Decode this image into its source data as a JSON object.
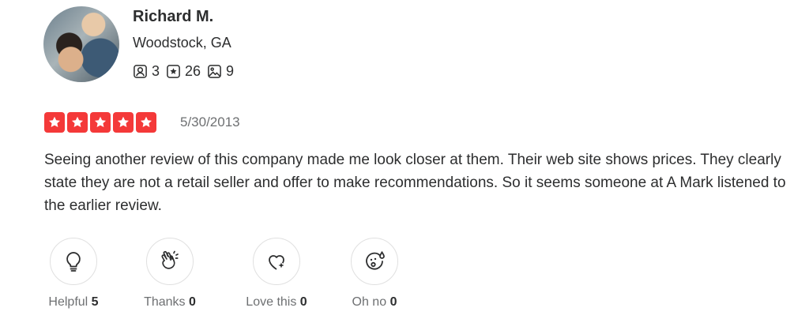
{
  "reviewer": {
    "name": "Richard M.",
    "location": "Woodstock, GA",
    "stats": [
      {
        "icon": "friends-icon",
        "value": "3"
      },
      {
        "icon": "reviews-star-icon",
        "value": "26"
      },
      {
        "icon": "photos-icon",
        "value": "9"
      }
    ]
  },
  "review": {
    "rating": 5,
    "max_rating": 5,
    "date": "5/30/2013",
    "text": "Seeing another review of this company made me look closer at them. Their web site shows prices. They clearly state they are not a retail seller and offer to make recommendations. So it seems someone at A Mark listened to the earlier review."
  },
  "reactions": [
    {
      "icon": "lightbulb-icon",
      "label": "Helpful",
      "count": "5"
    },
    {
      "icon": "clapping-hands-icon",
      "label": "Thanks",
      "count": "0"
    },
    {
      "icon": "heart-sparkle-icon",
      "label": "Love this",
      "count": "0"
    },
    {
      "icon": "surprised-face-icon",
      "label": "Oh no",
      "count": "0"
    }
  ],
  "colors": {
    "star": "#f43939",
    "text": "#2d2e2f",
    "muted": "#6e7072"
  }
}
